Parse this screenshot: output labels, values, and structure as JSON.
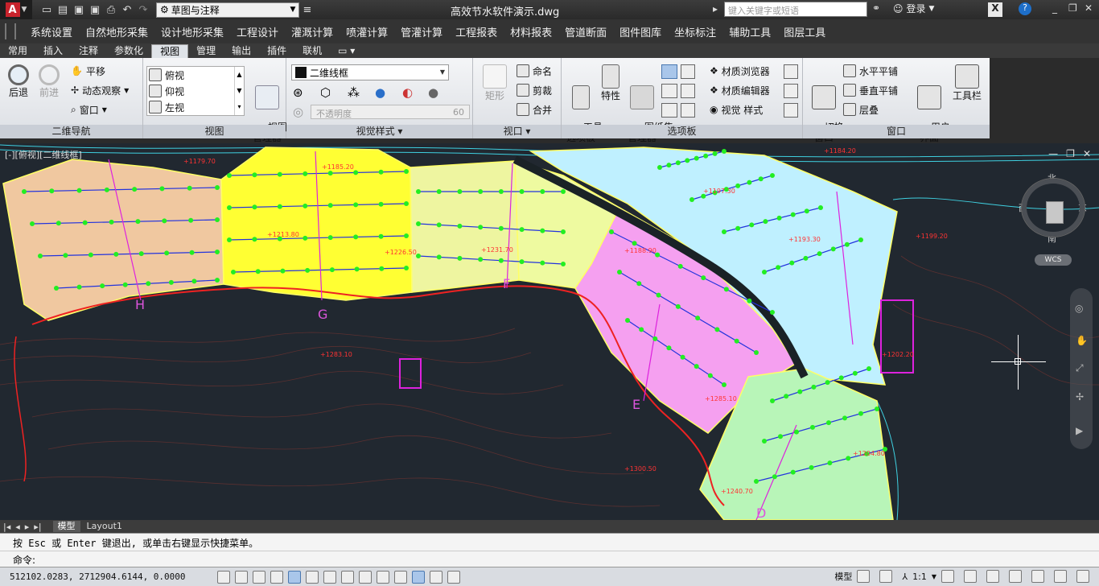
{
  "titlebar": {
    "workspace": "草图与注释",
    "doc_title": "高效节水软件演示.dwg",
    "search_placeholder": "键入关键字或短语",
    "login": "登录"
  },
  "menubar": {
    "items": [
      "系统设置",
      "自然地形采集",
      "设计地形采集",
      "工程设计",
      "灌溉计算",
      "喷灌计算",
      "管灌计算",
      "工程报表",
      "材料报表",
      "管道断面",
      "图件图库",
      "坐标标注",
      "辅助工具",
      "图层工具"
    ]
  },
  "ribbon_tabs": {
    "items": [
      "常用",
      "插入",
      "注释",
      "参数化",
      "视图",
      "管理",
      "输出",
      "插件",
      "联机"
    ],
    "active": "视图"
  },
  "ribbon": {
    "nav_panel": {
      "title": "二维导航",
      "back": "后退",
      "forward": "前进",
      "pan": "平移",
      "orbit": "动态观察",
      "window": "窗口"
    },
    "view_panel": {
      "title": "视图",
      "views": [
        "俯视",
        "仰视",
        "左视"
      ],
      "manager": "视图\n管理器"
    },
    "visual_panel": {
      "title": "视觉样式",
      "style": "二维线框",
      "opacity_label": "不透明度",
      "opacity_value": "60"
    },
    "viewport_panel": {
      "title": "视口",
      "rect": "矩形",
      "name": "命名",
      "clip": "剪裁",
      "join": "合并"
    },
    "palettes_panel": {
      "title": "选项板",
      "tool_palettes": "工具\n选项板",
      "properties": "特性",
      "sheet_set": "图纸集\n管理器",
      "mat_browser": "材质浏览器",
      "mat_editor": "材质编辑器",
      "visual_styles": "视觉  样式"
    },
    "window_panel": {
      "title": "窗口",
      "switch": "切换\n窗口",
      "tile_h": "水平平铺",
      "tile_v": "垂直平铺",
      "cascade": "层叠",
      "user_iface": "用户\n界面",
      "toolbars": "工具栏"
    }
  },
  "viewport": {
    "label": "[-][俯视][二维线框]",
    "viewcube": {
      "north": "北",
      "south": "南",
      "east": "东",
      "west": "西",
      "wcs": "WCS"
    },
    "labels": [
      {
        "text": "+1179.70"
      },
      {
        "text": "+1185.20"
      },
      {
        "text": "+1184.20"
      },
      {
        "text": "+1193.30"
      },
      {
        "text": "+1199.20"
      },
      {
        "text": "+1213.80"
      },
      {
        "text": "+1226.50"
      },
      {
        "text": "+1231.70"
      },
      {
        "text": "+1188.90"
      },
      {
        "text": "+1197.30"
      },
      {
        "text": "+1283.10"
      },
      {
        "text": "+1285.10"
      },
      {
        "text": "+1300.50"
      },
      {
        "text": "+1240.70"
      },
      {
        "text": "+1204.80"
      },
      {
        "text": "+1202.20"
      }
    ],
    "zone_letters": [
      "H",
      "G",
      "F",
      "E",
      "D"
    ]
  },
  "layout_tabs": {
    "items": [
      "模型",
      "Layout1"
    ],
    "active": "模型"
  },
  "command": {
    "history": "按 Esc 或 Enter 键退出, 或单击右键显示快捷菜单。",
    "prompt": "命令:"
  },
  "status": {
    "coords": "512102.0283, 2712904.6144, 0.0000",
    "model": "模型",
    "scale": "1:1"
  }
}
